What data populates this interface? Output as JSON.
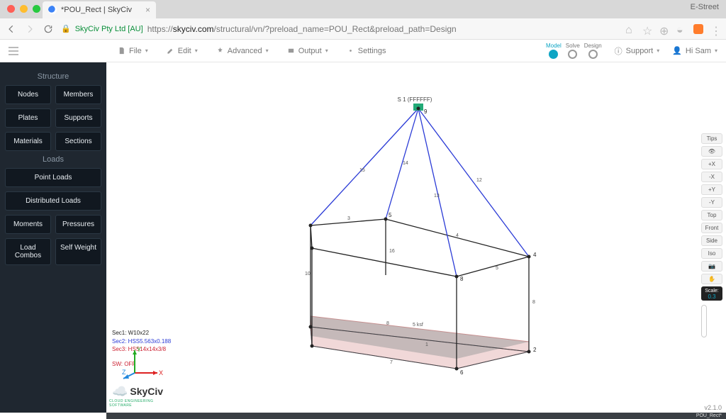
{
  "browser": {
    "tab_title": "*POU_Rect | SkyCiv",
    "profile": "E-Street",
    "organization": "SkyCiv Pty Ltd [AU]",
    "url_scheme": "https://",
    "url_host": "skyciv.com",
    "url_path": "/structural/vn/?preload_name=POU_Rect&preload_path=Design"
  },
  "toolbar": {
    "file": "File",
    "edit": "Edit",
    "advanced": "Advanced",
    "output": "Output",
    "settings": "Settings",
    "steps": {
      "model": "Model",
      "solve": "Solve",
      "design": "Design"
    },
    "support": "Support",
    "user": "Hi Sam"
  },
  "sidebar": {
    "structure_heading": "Structure",
    "nodes": "Nodes",
    "members": "Members",
    "plates": "Plates",
    "supports": "Supports",
    "materials": "Materials",
    "sections": "Sections",
    "loads_heading": "Loads",
    "point_loads": "Point Loads",
    "distributed_loads": "Distributed Loads",
    "moments": "Moments",
    "pressures": "Pressures",
    "load_combos": "Load Combos",
    "self_weight": "Self Weight"
  },
  "righttools": {
    "tips": "Tips",
    "eye": "👁",
    "px": "+X",
    "mx": "-X",
    "py": "+Y",
    "my": "-Y",
    "top": "Top",
    "front": "Front",
    "side": "Side",
    "iso": "Iso",
    "camera": "📷",
    "hand": "✋",
    "scale_label": "Scale:",
    "scale_value": "0.3"
  },
  "legend": {
    "sec1": "Sec1: W10x22",
    "sec2": "Sec2: HSS5.563x0.188",
    "sec3": "Sec3: HSS14x14x3/8",
    "sw": "SW: OFF"
  },
  "viewport": {
    "top_label": "S 1 (FFFFFF)",
    "plate_load": "5 ksf"
  },
  "logo": {
    "brand": "SkyCiv",
    "tagline": "CLOUD ENGINEERING SOFTWARE"
  },
  "footer": {
    "version": "v2.1.0",
    "status": "POU_Rect*"
  },
  "triad": {
    "x": "X",
    "y": "Y",
    "z": "Z"
  }
}
